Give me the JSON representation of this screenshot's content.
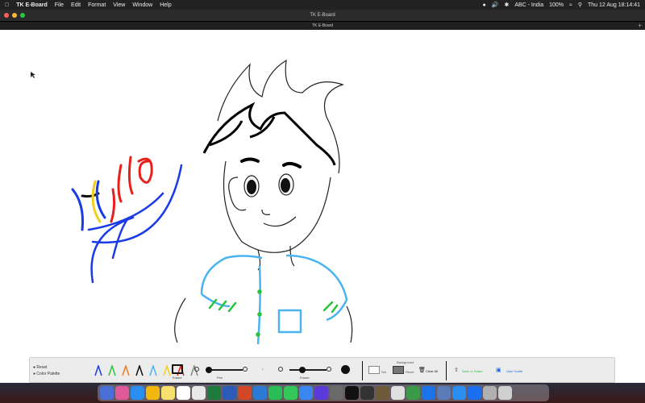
{
  "menubar": {
    "app_name": "TK E-Board",
    "items": [
      "File",
      "Edit",
      "Format",
      "View",
      "Window",
      "Help"
    ],
    "input_source": "ABC - India",
    "battery": "100%",
    "datetime": "Thu 12 Aug  18:14:41"
  },
  "window": {
    "title": "TK E-Board",
    "tab_title": "TK E-Board"
  },
  "canvas": {
    "handwriting": "Hello"
  },
  "toolbar": {
    "reset_label": "Reset",
    "color_palette_label": "Color Palette",
    "eraser_label": "Eraser",
    "pen_label": "Pen",
    "eraser_size_label": "Eraser",
    "background_label": "Background",
    "set_label": "Set",
    "reset_bg_label": "Reset",
    "clear_all_label": "Clear All",
    "save_share_label": "Save or Share",
    "user_guide_label": "User Guide",
    "pen_colors": [
      "#1a3be8",
      "#28c23b",
      "#f07a1c",
      "#111111",
      "#4ab3f0",
      "#f0d01c",
      "#e8201c",
      "#888888"
    ]
  }
}
